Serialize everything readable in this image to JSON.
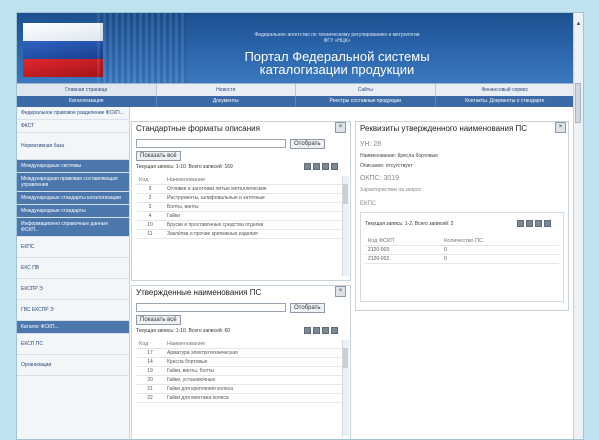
{
  "header": {
    "agency": "Федеральное агентство по техническому регулированию и метрологии\nФГУ «НЦК»",
    "title_line1": "Портал Федеральной системы",
    "title_line2": "каталогизации продукции"
  },
  "nav_top": [
    "Главная страница",
    "Новости",
    "Сайты",
    "Финансовый сервис"
  ],
  "nav_second": [
    "Каталогизация",
    "Документы",
    "Реестры составные продукции",
    "Контакты. Документы о стандарте"
  ],
  "sidebar": [
    "Федеральное правовое разделение ФСКП...",
    "ФКСТ",
    "Нормативная база",
    "Международные системы",
    "Международная правовая составляющая управления",
    "Международные стандарты каталогизации",
    "Международные стандарты",
    "Информационно справочные данные ФСКП...",
    "ЕКПС",
    "ЕКС ПВ",
    "ЕКСПР Э",
    "ГВС ЕКСПР Э",
    "Каталог ФСКП...",
    "ЕКСП ПС",
    "Организации"
  ],
  "panel_formats": {
    "title": "Стандартные форматы описания",
    "search_button": "Отобрать",
    "show_all": "Показать всё",
    "status": "Текущая запись: 1-10. Всего записей: 169",
    "col_code": "Код",
    "col_name": "Наименование",
    "rows": [
      {
        "code": "9",
        "name": "Отливки и заготовки литые металлические"
      },
      {
        "code": "2",
        "name": "Инструменты, шлифовальные и заточные"
      },
      {
        "code": "3",
        "name": "Болты, винты"
      },
      {
        "code": "4",
        "name": "Гайки"
      },
      {
        "code": "10",
        "name": "Бруски и проставочные средства отделки"
      },
      {
        "code": "11",
        "name": "Заклёпки и прочие крепежные изделия"
      }
    ]
  },
  "panel_approved": {
    "title": "Утвержденные наименования ПС",
    "search_button": "Отобрать",
    "show_all": "Показать всё",
    "status": "Текущая запись: 1-10. Всего записей: 60",
    "col_code": "Код",
    "col_name": "Наименование",
    "rows": [
      {
        "code": "17",
        "name": "Арматура электротехническая"
      },
      {
        "code": "14",
        "name": "Кресла бортовые"
      },
      {
        "code": "19",
        "name": "Гайки, винты, болты"
      },
      {
        "code": "20",
        "name": "Гайки, установочные"
      },
      {
        "code": "21",
        "name": "Гайки для крепления колеса"
      },
      {
        "code": "22",
        "name": "Гайки для монтажа колеса"
      }
    ]
  },
  "panel_details": {
    "title": "Реквизиты утвержденного наименования ПС",
    "fields": [
      "УН: 28",
      "Наименование: Кресла бортовые",
      "Описание: отсутствует",
      "ОКПС: 3019",
      "Характеристики на запрос",
      "ЕКПС"
    ],
    "status": "Текущая запись: 1-2. Всего записей: 2",
    "col_code": "Код ФСКП",
    "col_count": "Количество ПС",
    "rows": [
      {
        "code": "2120-003",
        "count": "0"
      },
      {
        "code": "2120-002",
        "count": "0"
      }
    ]
  }
}
